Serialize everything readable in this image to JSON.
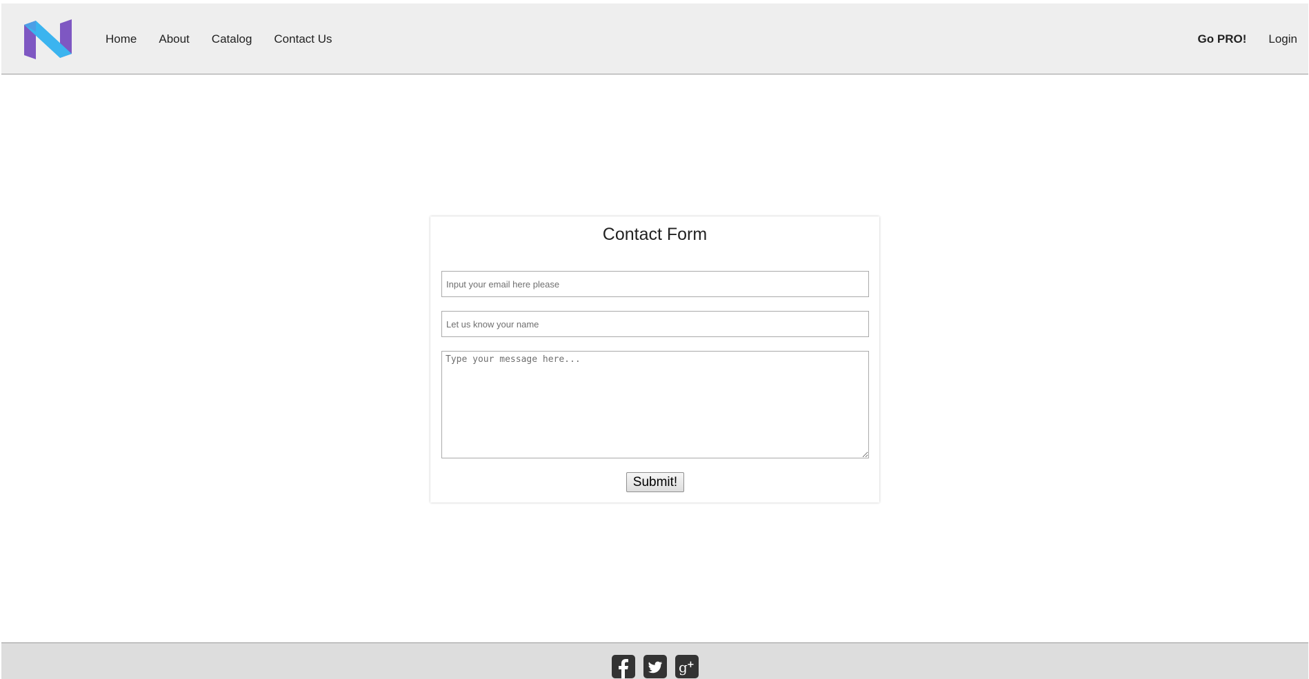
{
  "header": {
    "nav": {
      "home": "Home",
      "about": "About",
      "catalog": "Catalog",
      "contact": "Contact Us"
    },
    "right": {
      "pro": "Go PRO!",
      "login": "Login"
    }
  },
  "form": {
    "title": "Contact Form",
    "email_placeholder": "Input your email here please",
    "name_placeholder": "Let us know your name",
    "message_placeholder": "Type your message here...",
    "submit_label": "Submit!"
  },
  "footer": {
    "icons": [
      "facebook-icon",
      "twitter-icon",
      "google-plus-icon"
    ]
  },
  "colors": {
    "header_bg": "#eeeeee",
    "footer_bg": "#dddddd",
    "logo_purple": "#7e57c2",
    "logo_cyan": "#3bb4ef",
    "social_icon": "#333333"
  }
}
